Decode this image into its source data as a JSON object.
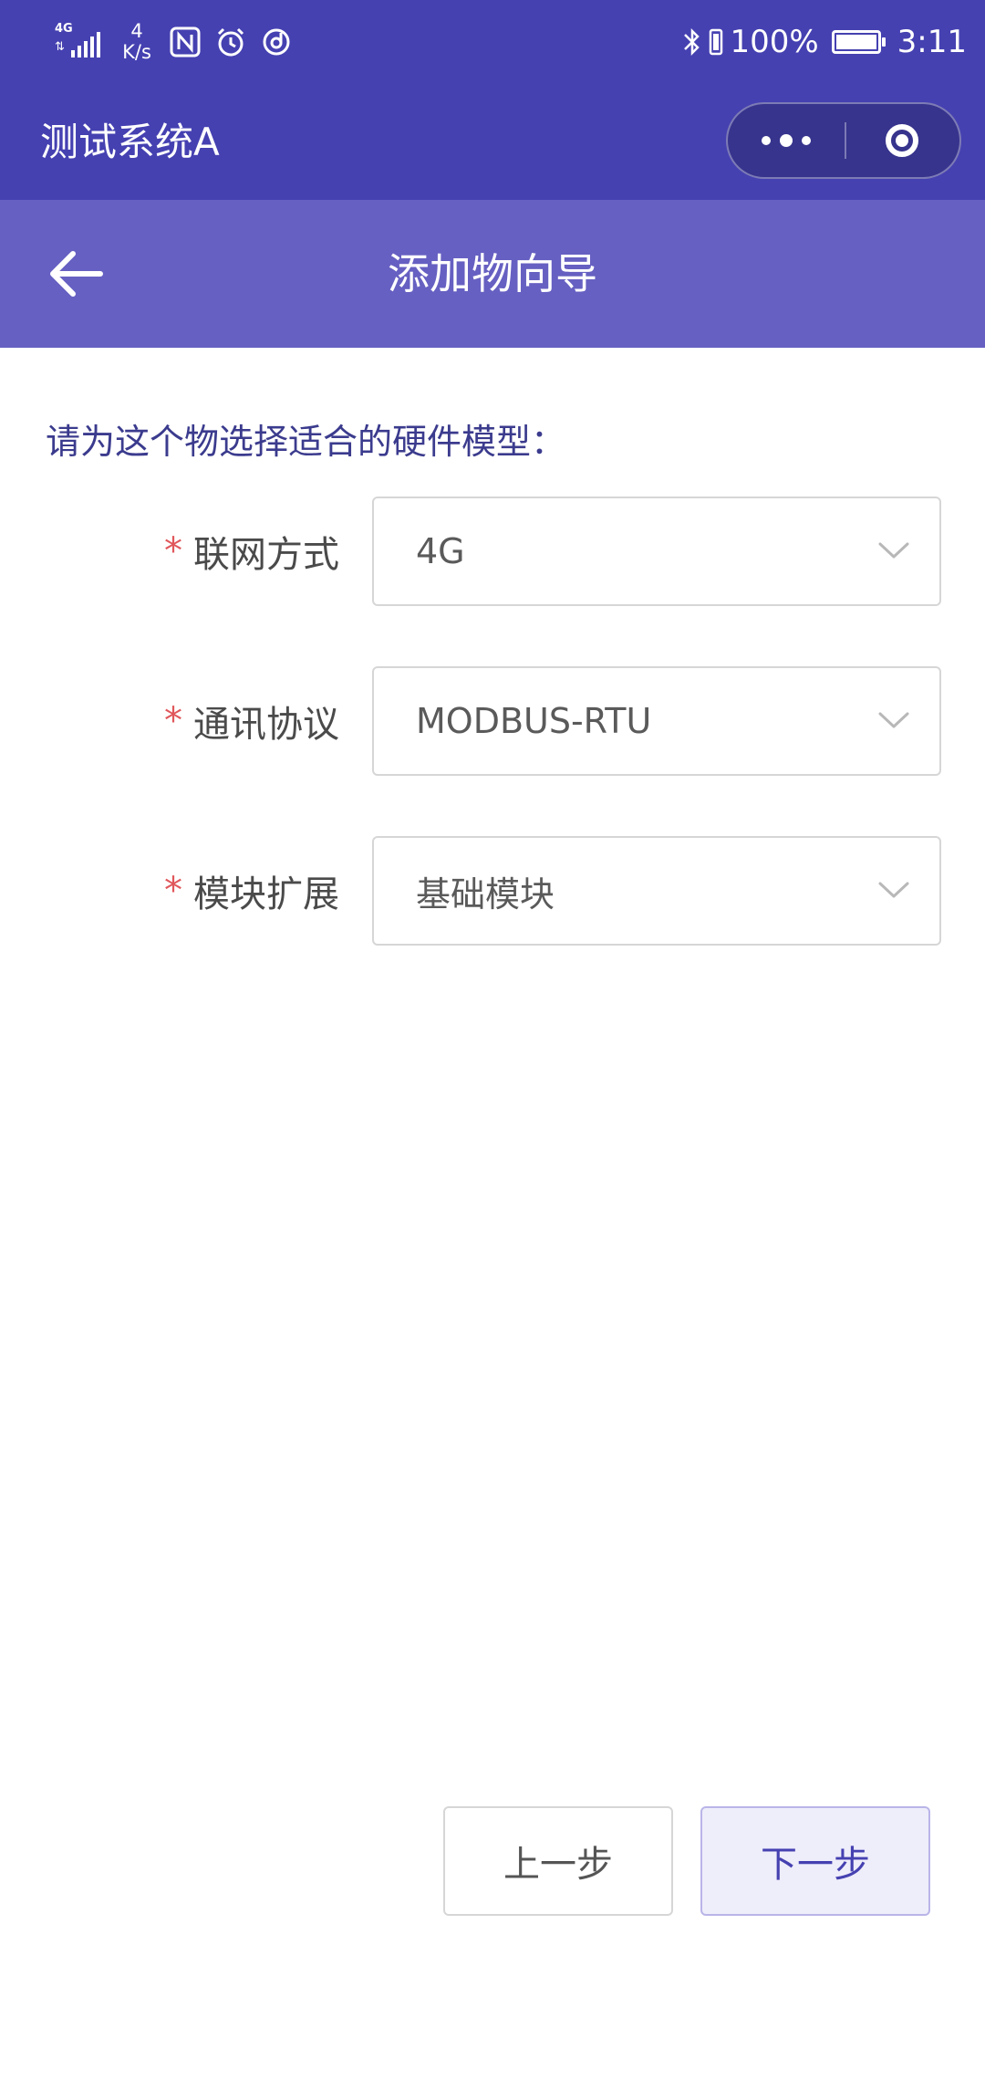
{
  "status_bar": {
    "network": "4G",
    "speed_value": "4",
    "speed_unit": "K/s",
    "battery": "100%",
    "time": "3:11"
  },
  "app": {
    "title": "测试系统A"
  },
  "nav": {
    "title": "添加物向导"
  },
  "form": {
    "prompt": "请为这个物选择适合的硬件模型：",
    "required_mark": "*",
    "fields": [
      {
        "label": "联网方式",
        "value": "4G"
      },
      {
        "label": "通讯协议",
        "value": "MODBUS-RTU"
      },
      {
        "label": "模块扩展",
        "value": "基础模块"
      }
    ]
  },
  "buttons": {
    "prev": "上一步",
    "next": "下一步"
  },
  "colors": {
    "header_bg": "#4541b1",
    "navbar_bg": "#6660c2",
    "required": "#e0575b",
    "prompt_text": "#3b3b8e",
    "next_button_bg": "#eeedfa"
  }
}
